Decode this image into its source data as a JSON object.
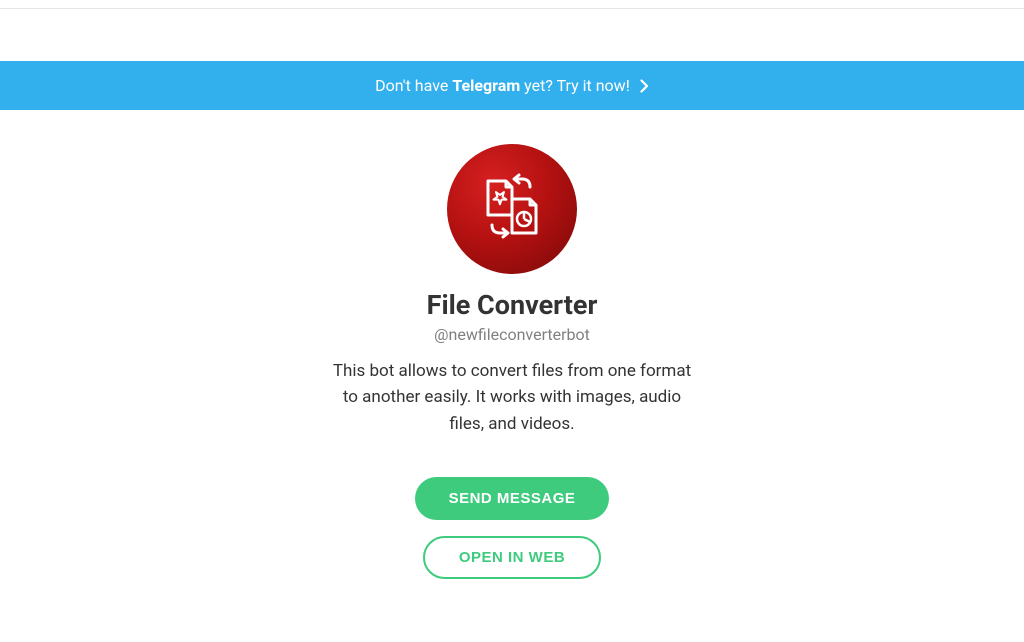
{
  "banner": {
    "prefix": "Don't have ",
    "bold": "Telegram",
    "suffix": " yet? Try it now!"
  },
  "profile": {
    "title": "File Converter",
    "handle": "@newfileconverterbot",
    "description": "This bot allows to convert files from one format to another easily. It works with images, audio files, and videos."
  },
  "buttons": {
    "send_message": "SEND MESSAGE",
    "open_in_web": "OPEN IN WEB"
  }
}
